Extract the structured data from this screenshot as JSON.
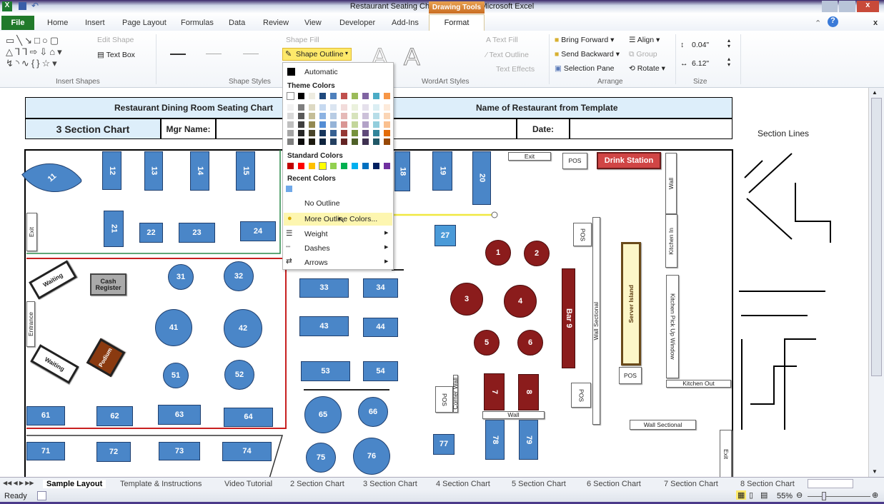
{
  "window": {
    "title": "Restaurant Seating Chart Final.xlsx - Microsoft Excel",
    "contextual_tab": "Drawing Tools"
  },
  "tabs": [
    "File",
    "Home",
    "Insert",
    "Page Layout",
    "Formulas",
    "Data",
    "Review",
    "View",
    "Developer",
    "Add-Ins",
    "Format"
  ],
  "ribbon": {
    "insert_shapes": {
      "edit_shape": "Edit Shape",
      "text_box": "Text Box",
      "label": "Insert Shapes"
    },
    "shape_styles": {
      "shape_fill": "Shape Fill",
      "shape_outline": "Shape Outline",
      "label": "Shape Styles"
    },
    "wordart": {
      "text_fill": "Text Fill",
      "text_outline": "Text Outline",
      "text_effects": "Text Effects",
      "label": "WordArt Styles"
    },
    "arrange": {
      "bring_forward": "Bring Forward",
      "send_backward": "Send Backward",
      "selection_pane": "Selection Pane",
      "align": "Align",
      "group": "Group",
      "rotate": "Rotate",
      "label": "Arrange"
    },
    "size": {
      "height": "0.04\"",
      "width": "6.12\"",
      "label": "Size"
    }
  },
  "dropdown": {
    "automatic": "Automatic",
    "theme_colors": "Theme Colors",
    "standard_colors": "Standard Colors",
    "recent_colors": "Recent Colors",
    "no_outline": "No Outline",
    "more_colors": "More Outline Colors...",
    "weight": "Weight",
    "dashes": "Dashes",
    "arrows": "Arrows",
    "theme_top": [
      "#ffffff",
      "#000000",
      "#eeece1",
      "#1f497d",
      "#4f81bd",
      "#c0504d",
      "#9bbb59",
      "#8064a2",
      "#4bacc6",
      "#f79646"
    ],
    "theme_shades": [
      [
        "#f2f2f2",
        "#7f7f7f",
        "#ddd9c3",
        "#c6d9f0",
        "#dbe5f1",
        "#f2dcdb",
        "#ebf1dd",
        "#e5e0ec",
        "#dbeef3",
        "#fdeada"
      ],
      [
        "#d8d8d8",
        "#595959",
        "#c4bd97",
        "#8db3e2",
        "#b8cce4",
        "#e5b9b7",
        "#d7e3bc",
        "#ccc1d9",
        "#b7dde8",
        "#fbd5b5"
      ],
      [
        "#bfbfbf",
        "#3f3f3f",
        "#938953",
        "#548dd4",
        "#95b3d7",
        "#d99694",
        "#c3d69b",
        "#b2a2c7",
        "#92cddc",
        "#fac08f"
      ],
      [
        "#a5a5a5",
        "#262626",
        "#494429",
        "#17365d",
        "#366092",
        "#953734",
        "#76923c",
        "#5f497a",
        "#31859b",
        "#e36c09"
      ],
      [
        "#7f7f7f",
        "#0c0c0c",
        "#1d1b10",
        "#0f243e",
        "#244061",
        "#632423",
        "#4f6128",
        "#3f3151",
        "#205867",
        "#974806"
      ]
    ],
    "standard": [
      "#c00000",
      "#ff0000",
      "#ffc000",
      "#ffff00",
      "#92d050",
      "#00b050",
      "#00b0f0",
      "#0070c0",
      "#002060",
      "#7030a0"
    ],
    "recent": [
      "#6fa8e8"
    ]
  },
  "header": {
    "title": "Restaurant Dining Room Seating Chart",
    "restaurant": "Name of Restaurant from Template",
    "section": "3 Section Chart",
    "mgr": "Mgr Name:",
    "date": "Date:"
  },
  "floor": {
    "items": [
      {
        "label": "11",
        "kind": "blue"
      },
      {
        "label": "12",
        "kind": "blue"
      },
      {
        "label": "13",
        "kind": "blue"
      },
      {
        "label": "14",
        "kind": "blue"
      },
      {
        "label": "15",
        "kind": "blue"
      },
      {
        "label": "18",
        "kind": "blue"
      },
      {
        "label": "19",
        "kind": "blue"
      },
      {
        "label": "20",
        "kind": "blue"
      },
      {
        "label": "21",
        "kind": "blue"
      },
      {
        "label": "22",
        "kind": "blue"
      },
      {
        "label": "23",
        "kind": "blue"
      },
      {
        "label": "24",
        "kind": "blue"
      },
      {
        "label": "27",
        "kind": "blue"
      },
      {
        "label": "31",
        "kind": "blue"
      },
      {
        "label": "32",
        "kind": "blue"
      },
      {
        "label": "41",
        "kind": "blue"
      },
      {
        "label": "42",
        "kind": "blue"
      },
      {
        "label": "51",
        "kind": "blue"
      },
      {
        "label": "52",
        "kind": "blue"
      },
      {
        "label": "33",
        "kind": "blue"
      },
      {
        "label": "34",
        "kind": "blue"
      },
      {
        "label": "43",
        "kind": "blue"
      },
      {
        "label": "44",
        "kind": "blue"
      },
      {
        "label": "53",
        "kind": "blue"
      },
      {
        "label": "54",
        "kind": "blue"
      },
      {
        "label": "61",
        "kind": "blue"
      },
      {
        "label": "62",
        "kind": "blue"
      },
      {
        "label": "63",
        "kind": "blue"
      },
      {
        "label": "64",
        "kind": "blue"
      },
      {
        "label": "65",
        "kind": "blue"
      },
      {
        "label": "66",
        "kind": "blue"
      },
      {
        "label": "71",
        "kind": "blue"
      },
      {
        "label": "72",
        "kind": "blue"
      },
      {
        "label": "73",
        "kind": "blue"
      },
      {
        "label": "74",
        "kind": "blue"
      },
      {
        "label": "75",
        "kind": "blue"
      },
      {
        "label": "76",
        "kind": "blue"
      },
      {
        "label": "77",
        "kind": "blue"
      },
      {
        "label": "78",
        "kind": "blue"
      },
      {
        "label": "79",
        "kind": "blue"
      },
      {
        "label": "1",
        "kind": "red"
      },
      {
        "label": "2",
        "kind": "red"
      },
      {
        "label": "3",
        "kind": "red"
      },
      {
        "label": "4",
        "kind": "red"
      },
      {
        "label": "5",
        "kind": "red"
      },
      {
        "label": "6",
        "kind": "red"
      },
      {
        "label": "7",
        "kind": "red"
      },
      {
        "label": "8",
        "kind": "red"
      },
      {
        "label": "Bar 9",
        "kind": "red"
      },
      {
        "label": "Exit",
        "kind": "fixture"
      },
      {
        "label": "POS",
        "kind": "fixture"
      },
      {
        "label": "Drink Station",
        "kind": "drink"
      },
      {
        "label": "Wall",
        "kind": "fixture"
      },
      {
        "label": "Kitchen In",
        "kind": "fixture"
      },
      {
        "label": "Kitchen Pick Up Window",
        "kind": "fixture"
      },
      {
        "label": "Kitchen Out",
        "kind": "fixture"
      },
      {
        "label": "Server Island",
        "kind": "island"
      },
      {
        "label": "POS",
        "kind": "fixture"
      },
      {
        "label": "POS",
        "kind": "fixture"
      },
      {
        "label": "Wall Sectional",
        "kind": "fixture"
      },
      {
        "label": "POS",
        "kind": "fixture"
      },
      {
        "label": "POS",
        "kind": "fixture"
      },
      {
        "label": "Corner Wall",
        "kind": "fixture"
      },
      {
        "label": "Wall",
        "kind": "fixture"
      },
      {
        "label": "Wall Sectional",
        "kind": "fixture"
      },
      {
        "label": "Exit",
        "kind": "fixture"
      },
      {
        "label": "Exit",
        "kind": "fixture"
      },
      {
        "label": "Entrance",
        "kind": "fixture"
      },
      {
        "label": "Waiting",
        "kind": "fixture"
      },
      {
        "label": "Waiting",
        "kind": "fixture"
      },
      {
        "label": "Cash Register",
        "kind": "register"
      },
      {
        "label": "Podium",
        "kind": "podium"
      }
    ]
  },
  "side": {
    "section_lines": "Section Lines"
  },
  "sheet_tabs": [
    "Sample Layout",
    "Template & Instructions",
    "Video Tutorial",
    "2 Section Chart",
    "3 Section Chart",
    "4 Section Chart",
    "5 Section Chart",
    "6 Section Chart",
    "7 Section Chart",
    "8 Section Chart"
  ],
  "status": {
    "ready": "Ready",
    "zoom": "55%"
  }
}
